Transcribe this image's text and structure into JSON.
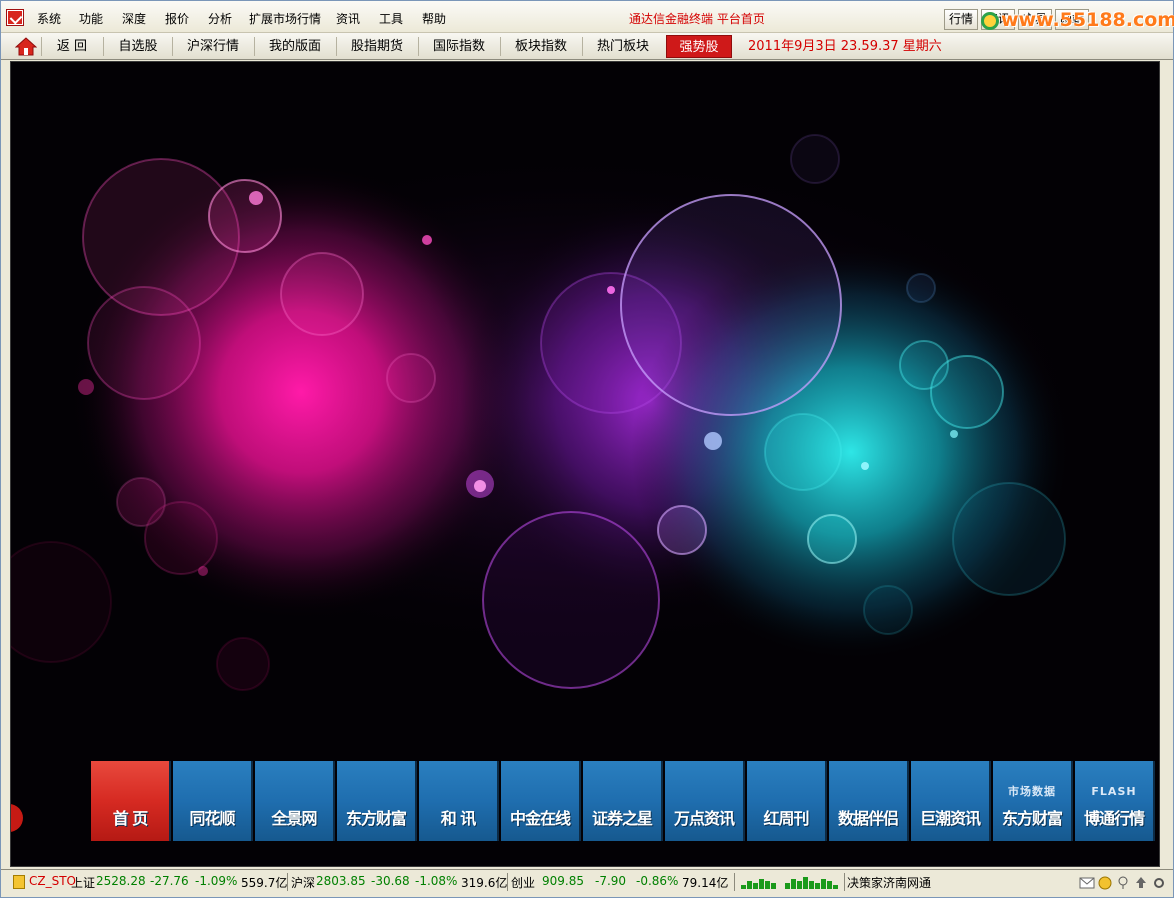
{
  "menu": {
    "items": [
      "系统",
      "功能",
      "深度",
      "报价",
      "分析",
      "扩展市场行情",
      "资讯",
      "工具",
      "帮助"
    ],
    "platform_title": "通达信金融终端  平台首页",
    "right_buttons": [
      "行情",
      "资讯",
      "交易",
      "网站"
    ],
    "watermark": "www.55188.com"
  },
  "nav": {
    "back": "返 回",
    "items": [
      "自选股",
      "沪深行情",
      "我的版面",
      "股指期货",
      "国际指数",
      "板块指数",
      "热门板块",
      "强势股"
    ],
    "active": "强势股",
    "datetime": "2011年9月3日  23.59.37 星期六"
  },
  "tiles": [
    {
      "label": "首  页",
      "sub": "",
      "active": true
    },
    {
      "label": "同花顺",
      "sub": ""
    },
    {
      "label": "全景网",
      "sub": ""
    },
    {
      "label": "东方财富",
      "sub": ""
    },
    {
      "label": "和  讯",
      "sub": ""
    },
    {
      "label": "中金在线",
      "sub": ""
    },
    {
      "label": "证券之星",
      "sub": ""
    },
    {
      "label": "万点资讯",
      "sub": ""
    },
    {
      "label": "红周刊",
      "sub": ""
    },
    {
      "label": "数据伴侣",
      "sub": ""
    },
    {
      "label": "巨潮资讯",
      "sub": ""
    },
    {
      "label": "东方财富",
      "sub": "市场数据"
    },
    {
      "label": "博通行情",
      "sub": "FLASH"
    }
  ],
  "status": {
    "account": "CZ_STO",
    "sh": {
      "name": "上证",
      "value": "2528.28",
      "change": "-27.76",
      "pct": "-1.09%",
      "amount": "559.7亿"
    },
    "sz": {
      "name": "沪深",
      "value": "2803.85",
      "change": "-30.68",
      "pct": "-1.08%",
      "amount": "319.6亿"
    },
    "cy": {
      "name": "创业",
      "value": "909.85",
      "change": "-7.90",
      "pct": "-0.86%",
      "amount": "79.14亿"
    },
    "server": "决策家济南网通"
  },
  "colors": {
    "tile_blue": "#1f6eaf",
    "tile_red": "#d62a22",
    "accent_red": "#d40000",
    "down_green": "#008000"
  }
}
